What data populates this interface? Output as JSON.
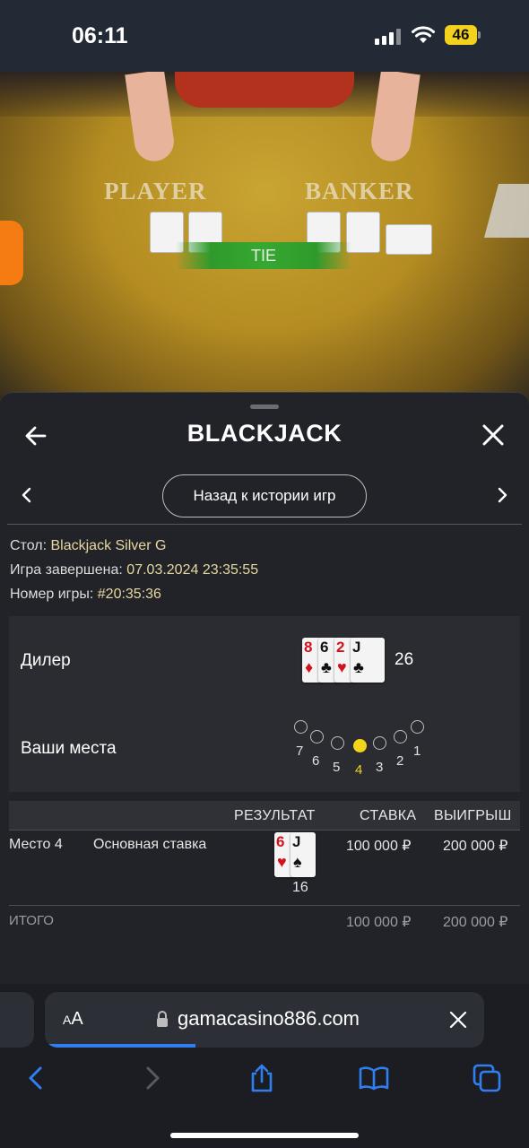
{
  "status_bar": {
    "time": "06:11",
    "battery": "46"
  },
  "game_view": {
    "player_label": "PLAYER",
    "banker_label": "BANKER",
    "tie_label": "TIE"
  },
  "panel": {
    "title": "BLACKJACK",
    "history_button": "Назад к истории игр",
    "table_label": "Стол:",
    "table_value": "Blackjack Silver G",
    "finished_label": "Игра завершена:",
    "finished_value": "07.03.2024 23:35:55",
    "game_number_label": "Номер игры:",
    "game_number_value": "#20:35:36",
    "dealer_label": "Дилер",
    "dealer_cards": [
      {
        "rank": "8",
        "suit": "♦",
        "color": "red"
      },
      {
        "rank": "6",
        "suit": "♣",
        "color": "black"
      },
      {
        "rank": "2",
        "suit": "♥",
        "color": "red"
      },
      {
        "rank": "J",
        "suit": "♣",
        "color": "black"
      }
    ],
    "dealer_total": "26",
    "seats_label": "Ваши места",
    "seats": [
      "7",
      "6",
      "5",
      "4",
      "3",
      "2",
      "1"
    ],
    "active_seat": "4"
  },
  "results_table": {
    "columns": [
      "РЕЗУЛЬТАТ",
      "СТАВКА",
      "ВЫИГРЫШ"
    ],
    "rows": [
      {
        "place": "Место 4",
        "bet_type": "Основная ставка",
        "cards": [
          {
            "rank": "6",
            "suit": "♥",
            "color": "red"
          },
          {
            "rank": "J",
            "suit": "♠",
            "color": "black"
          }
        ],
        "hand_total": "16",
        "stake": "100 000 ₽",
        "win": "200 000 ₽"
      }
    ],
    "total_label": "ИТОГО",
    "total_stake": "100 000 ₽",
    "total_win": "200 000 ₽"
  },
  "browser": {
    "aa_label": "AA",
    "url": "gamacasino886.com",
    "accent_color": "#2f7ff0"
  },
  "colors": {
    "active_seat": "#f3d51a",
    "tie_bar": "#36a830",
    "side_tab": "#f57c12"
  }
}
